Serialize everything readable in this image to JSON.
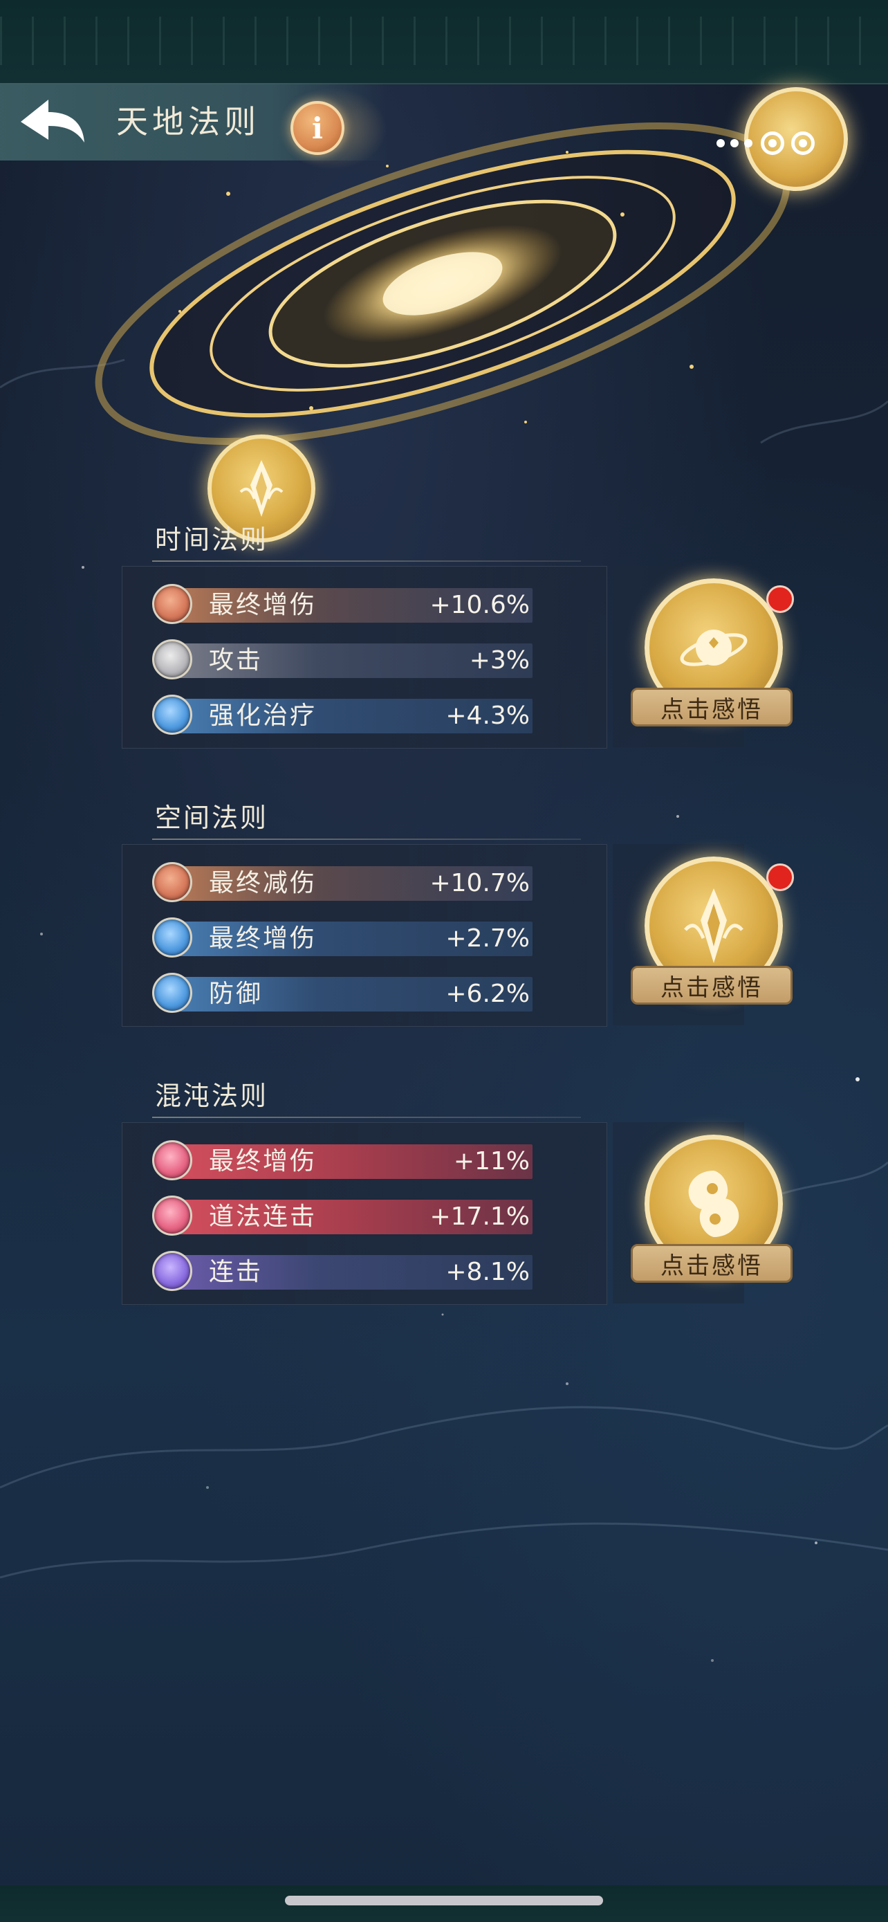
{
  "header": {
    "title": "天地法则",
    "back_icon": "back-arrow-icon",
    "info_label": "i"
  },
  "laws": [
    {
      "title": "时间法则",
      "has_red_dot": true,
      "button_label": "点击感悟",
      "emblem_icon": "planet-icon",
      "stats": [
        {
          "name": "最终增伤",
          "value": "+10.6%",
          "color": "orange"
        },
        {
          "name": "攻击",
          "value": "+3%",
          "color": "grey"
        },
        {
          "name": "强化治疗",
          "value": "+4.3%",
          "color": "blue"
        }
      ]
    },
    {
      "title": "空间法则",
      "has_red_dot": true,
      "button_label": "点击感悟",
      "emblem_icon": "crystal-icon",
      "stats": [
        {
          "name": "最终减伤",
          "value": "+10.7%",
          "color": "orange"
        },
        {
          "name": "最终增伤",
          "value": "+2.7%",
          "color": "blue"
        },
        {
          "name": "防御",
          "value": "+6.2%",
          "color": "blue"
        }
      ]
    },
    {
      "title": "混沌法则",
      "has_red_dot": false,
      "button_label": "点击感悟",
      "emblem_icon": "yin-yang-icon",
      "stats": [
        {
          "name": "最终增伤",
          "value": "+11%",
          "color": "red"
        },
        {
          "name": "道法连击",
          "value": "+17.1%",
          "color": "red"
        },
        {
          "name": "连击",
          "value": "+8.1%",
          "color": "purple"
        }
      ]
    }
  ],
  "colors": {
    "red_dot": "#e1241d",
    "gold": "#d8a944",
    "title_text": "#f1ead8"
  }
}
